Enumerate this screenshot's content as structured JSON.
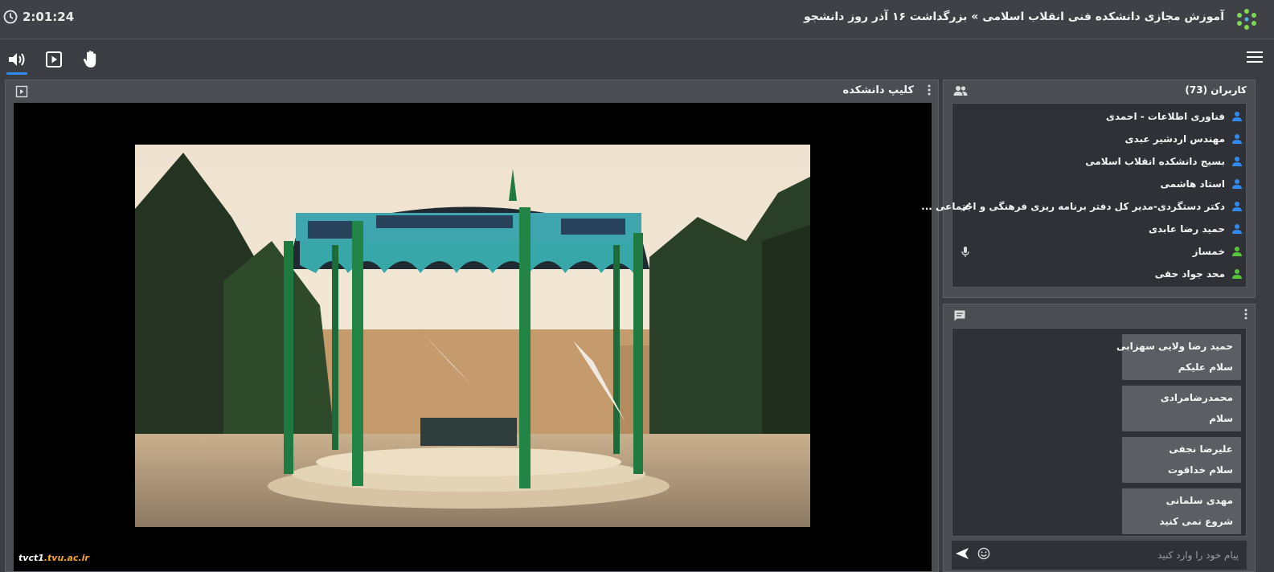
{
  "header": {
    "time": "2:01:24",
    "title": "آموزش مجازی دانشکده فنی انقلاب اسلامی » بزرگداشت ۱۶ آذر روز دانشجو"
  },
  "video": {
    "title": "کلیپ دانشکده",
    "watermark_main": "tvct1",
    "watermark_domain": ".tvu.ac.ir"
  },
  "users": {
    "title": "کاربران (73)",
    "items": [
      {
        "name": "فناوری اطلاعات - احمدی",
        "color": "#2f8bf0"
      },
      {
        "name": "مهندس اردشیر عبدی",
        "color": "#2f8bf0"
      },
      {
        "name": "بسیج دانشکده انقلاب اسلامی",
        "color": "#2f8bf0"
      },
      {
        "name": "استاد هاشمی",
        "color": "#2f8bf0"
      },
      {
        "name": "دکتر دستگردی-مدیر کل دفتر برنامه ریزی فرهنگی و اجتماعی ...",
        "color": "#2f8bf0"
      },
      {
        "name": "حمید رضا عابدی",
        "color": "#2f8bf0"
      },
      {
        "name": "خمساز",
        "color": "#54c63a"
      },
      {
        "name": "محد جواد حقی",
        "color": "#54c63a"
      }
    ]
  },
  "chat": {
    "messages": [
      {
        "author": "حمید رضا ولایی سهزابی",
        "text": "سلام علیکم"
      },
      {
        "author": "محمدرضامرادی",
        "text": "سلام"
      },
      {
        "author": "علیرضا نجفی",
        "text": "سلام  خداقوت"
      },
      {
        "author": "مهدی سلمانی",
        "text": "شروع نمی کنید"
      }
    ],
    "placeholder": "پیام خود را وارد کنید"
  },
  "colors": {
    "accent": "#2f8bf0",
    "moderator": "#2f8bf0",
    "viewer": "#54c63a"
  }
}
